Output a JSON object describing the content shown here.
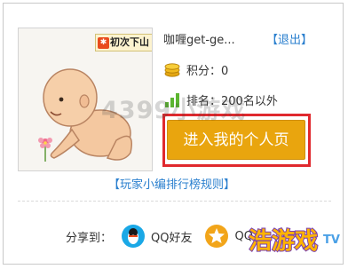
{
  "profile": {
    "username": "咖喱get-ge...",
    "logout_label": "【退出】",
    "level_badge": "初次下山",
    "level_badge_icon_glyph": "✱",
    "points_label": "积分：0",
    "rank_label": "排名：200名以外"
  },
  "actions": {
    "enter_button_label": "进入我的个人页",
    "rules_link_label": "【玩家小编排行榜规则】"
  },
  "share": {
    "label": "分享到：",
    "items": [
      {
        "label": "QQ好友",
        "icon": "qq-penguin-icon"
      },
      {
        "label": "QQ",
        "icon": "qzone-star-icon"
      }
    ]
  },
  "watermark": "4399小游戏",
  "logo_text": "浩游戏",
  "logo_sub_text": "TV",
  "colors": {
    "accent_button": "#e9a50e",
    "highlight_border": "#e0292e",
    "link": "#2a7fce",
    "share_icon_blue": "#1aa8e6",
    "share_icon_orange": "#f2a51a"
  }
}
